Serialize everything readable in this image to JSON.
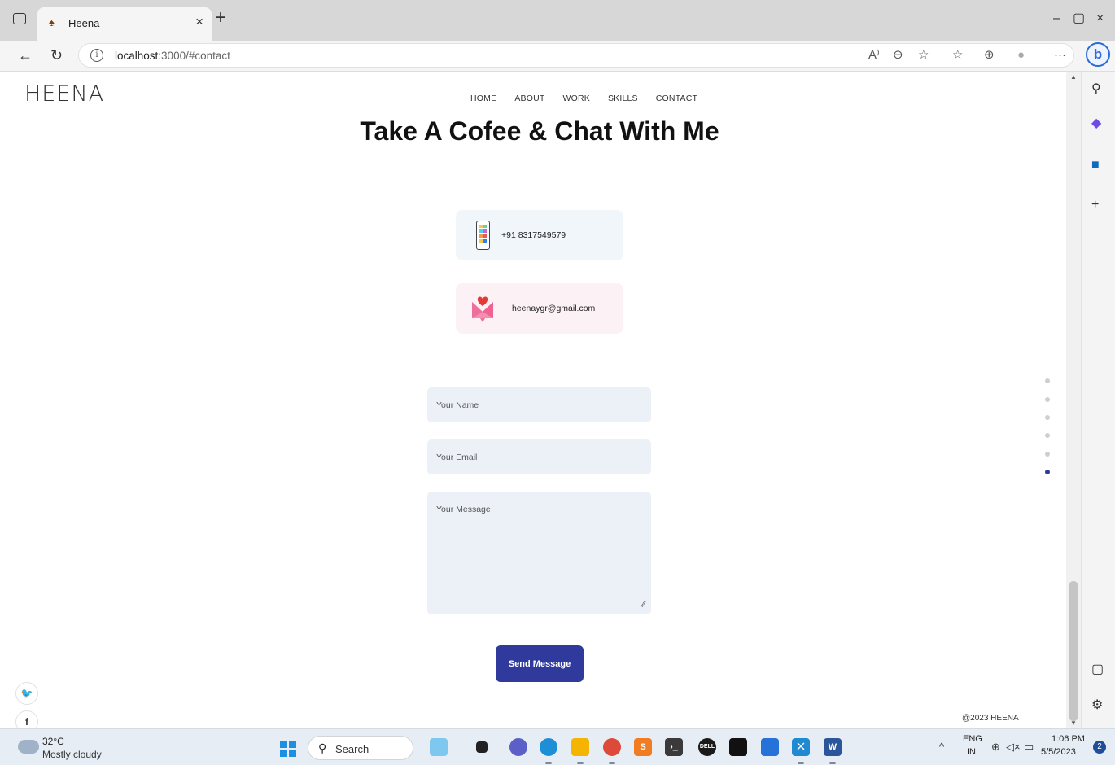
{
  "browser": {
    "tab_title": "Heena",
    "tab_close": "×",
    "new_tab": "+",
    "window_controls": {
      "minimize": "–",
      "restore": "▢",
      "close": "×"
    },
    "url_host": "localhost",
    "url_rest": ":3000/#contact",
    "icons": [
      "tab-actions-icon",
      "back-icon",
      "refresh-icon",
      "info-icon",
      "read-aloud-icon",
      "zoom-icon",
      "favorite-add-icon",
      "favorites-icon",
      "collections-icon",
      "profile-icon",
      "more-icon",
      "bing-icon"
    ],
    "more": "···",
    "bing": "b"
  },
  "sidebar": {
    "icons": [
      "search-icon",
      "copilot-icon",
      "outlook-icon",
      "add-icon",
      "split-screen-icon",
      "settings-icon"
    ]
  },
  "page": {
    "logo": "HEENA",
    "nav": [
      "HOME",
      "ABOUT",
      "WORK",
      "SKILLS",
      "CONTACT"
    ],
    "headline": "Take A Cofee & Chat With Me",
    "phone": "+91 8317549579",
    "email": "heenaygr@gmail.com",
    "form": {
      "name_placeholder": "Your Name",
      "email_placeholder": "Your Email",
      "message_placeholder": "Your Message",
      "submit": "Send Message"
    },
    "section_dots": {
      "count": 6,
      "active_index": 5
    },
    "social": [
      "twitter-icon",
      "facebook-icon"
    ],
    "social_glyphs": [
      "🐦",
      "f"
    ],
    "copyright": "@2023 HEENA",
    "accent_color": "#2f3a9c"
  },
  "taskbar": {
    "weather_temp": "32°C",
    "weather_desc": "Mostly cloudy",
    "search_label": "Search",
    "apps": [
      "photos-icon",
      "task-view-icon",
      "meet-icon",
      "edge-icon",
      "file-explorer-icon",
      "chrome-icon",
      "sublime-icon",
      "terminal-icon",
      "dell-icon",
      "cmd-icon",
      "store-icon",
      "vscode-icon",
      "word-icon"
    ],
    "lang_top": "ENG",
    "lang_bottom": "IN",
    "time": "1:06 PM",
    "date": "5/5/2023",
    "notifications": "2"
  }
}
